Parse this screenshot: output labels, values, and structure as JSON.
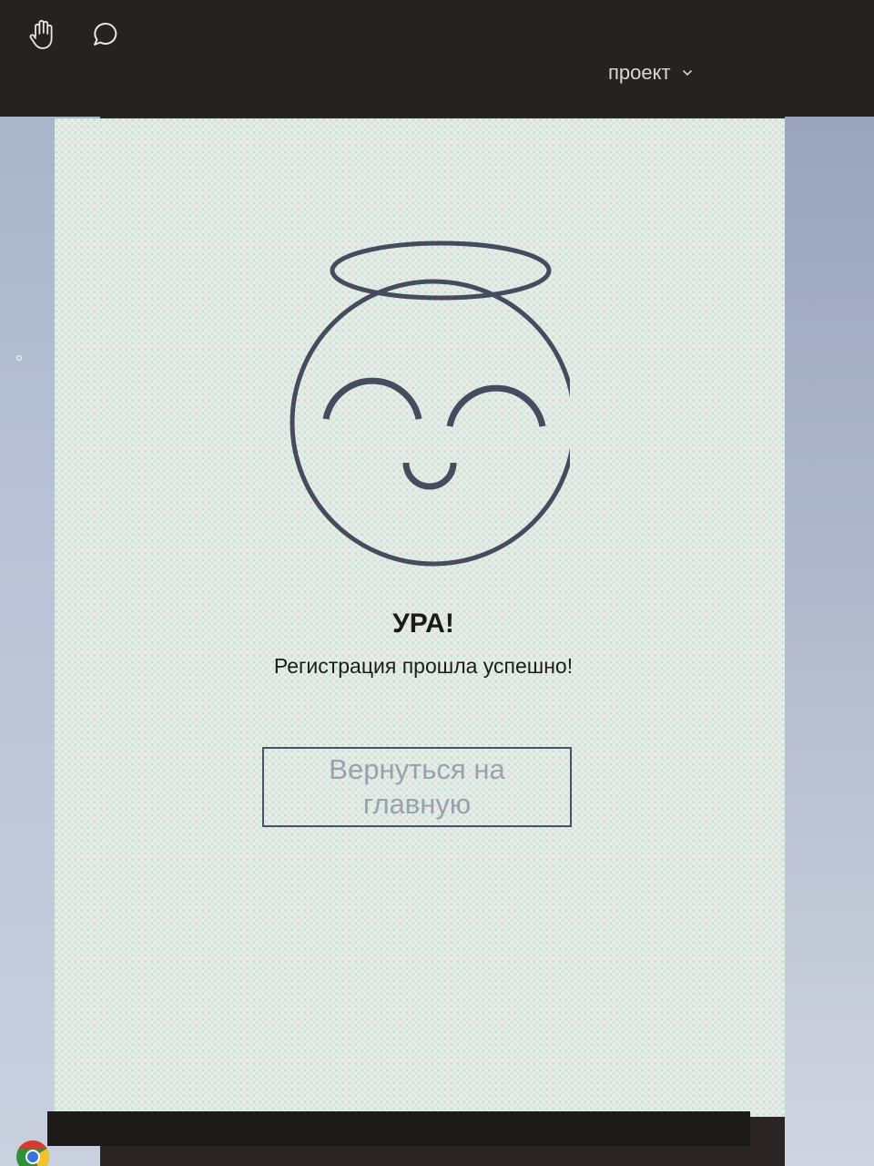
{
  "header": {
    "project_menu_label": "проект",
    "icons": [
      "hand-icon",
      "comment-icon",
      "chevron-down-icon"
    ]
  },
  "main": {
    "illustration": "angel-smiley-icon",
    "title": "УРА!",
    "message": "Регистрация прошла успешно!",
    "home_button_label": "Вернуться на главную"
  },
  "colors": {
    "illustration_stroke": "#474b5e",
    "card_background": "#e6eee8",
    "top_bar": "#262220"
  }
}
